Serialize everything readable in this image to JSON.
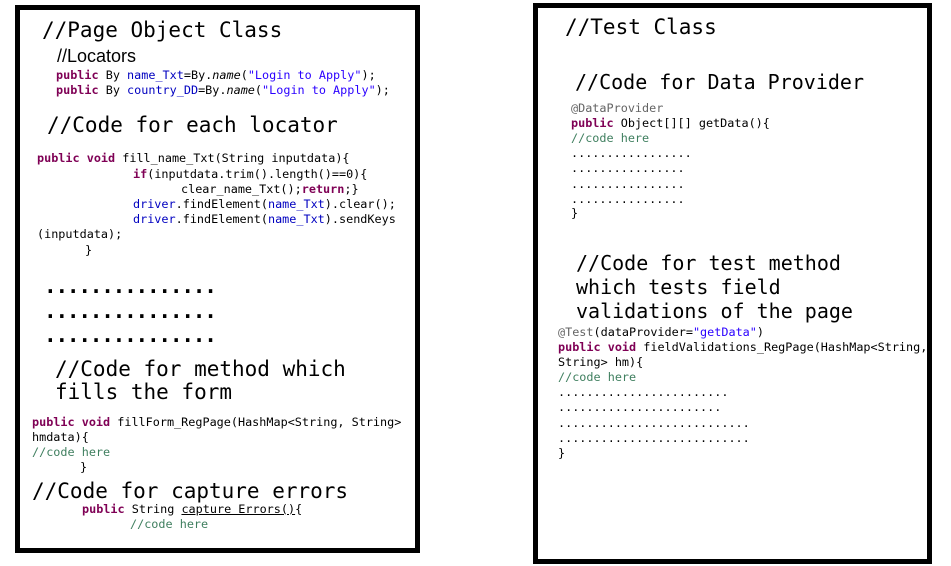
{
  "colors": {
    "keyword": "#7f0055",
    "string": "#2a00ff",
    "field": "#0000c0",
    "comment": "#3f7f5f",
    "annotation": "#646464",
    "border": "#000000"
  },
  "left": {
    "title": "//Page Object Class",
    "locators_label": "//Locators",
    "loc": [
      [
        "public",
        " By ",
        "name_Txt",
        "=By.",
        "name",
        "(",
        "\"Login to Apply\"",
        ");"
      ],
      [
        "public",
        " By ",
        "country_DD",
        "=By.",
        "name",
        "(",
        "\"Login to Apply\"",
        ");"
      ]
    ],
    "each_locator_heading": "//Code for each locator",
    "fill": [
      [
        "public void",
        " fill_name_Txt(String inputdata){"
      ],
      [
        "if",
        "(inputdata.trim().length()==0){"
      ],
      [
        "clear_name_Txt();",
        "return",
        ";}"
      ],
      [
        "driver",
        ".findElement(",
        "name_Txt",
        ").clear();"
      ],
      [
        "driver",
        ".findElement(",
        "name_Txt",
        ").sendKeys"
      ],
      [
        "(inputdata);"
      ],
      [
        "}"
      ]
    ],
    "dots": [
      "...............",
      "...............",
      "..............."
    ],
    "method_heading": [
      "//Code for method which",
      "fills the form"
    ],
    "form": [
      [
        "public void",
        " fillForm_RegPage(HashMap<String, String>"
      ],
      [
        "hmdata){"
      ],
      [
        "//code here"
      ],
      [
        "}"
      ]
    ],
    "capture_heading": "//Code for capture errors",
    "capture": [
      [
        "public",
        " String ",
        "capture Errors()",
        "{"
      ],
      [
        "//code here"
      ]
    ]
  },
  "right": {
    "title": "//Test Class",
    "dp_heading": "//Code for Data Provider",
    "dp": [
      [
        "@DataProvider"
      ],
      [
        "public",
        " Object[][] getData(){"
      ],
      [
        "//code here"
      ],
      [
        "................."
      ],
      [
        "................"
      ],
      [
        "................"
      ],
      [
        "................"
      ],
      [
        "}"
      ]
    ],
    "test_heading": [
      "//Code for test method",
      "which tests field",
      "validations of the page"
    ],
    "test": [
      [
        "@Test",
        "(dataProvider=",
        "\"getData\"",
        ")"
      ],
      [
        "public void",
        " fieldValidations_RegPage(HashMap<String,"
      ],
      [
        "String> hm){"
      ],
      [
        "//code here"
      ],
      [
        "........................"
      ],
      [
        "......................."
      ],
      [
        "..........................."
      ],
      [
        "..........................."
      ],
      [
        "}"
      ]
    ]
  }
}
